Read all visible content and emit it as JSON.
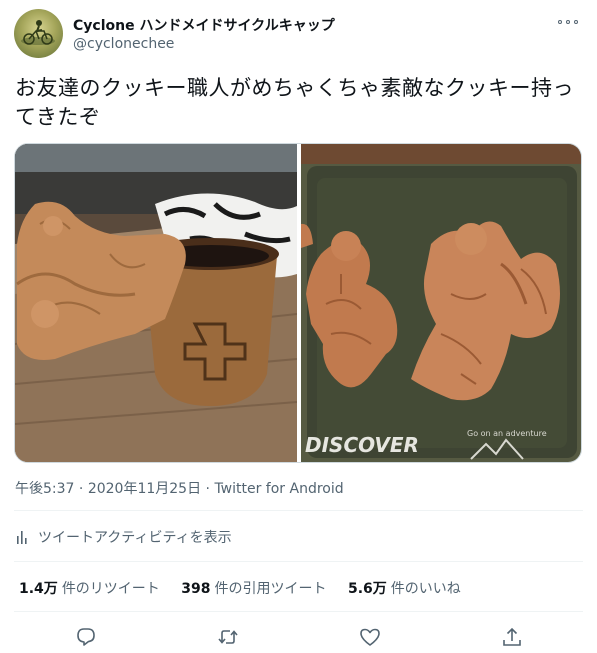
{
  "author": {
    "name": "Cyclone ハンドメイドサイクルキャップ",
    "handle": "@cyclonechee"
  },
  "tweet": {
    "text": "お友達のクッキー職人がめちゃくちゃ素敵なクッキー持ってきたぞ",
    "time": "午後5:37",
    "separator1": " · ",
    "date": "2020年11月25日",
    "separator2": " · ",
    "source": "Twitter for Android"
  },
  "media": {
    "photo2_tray_text": "DISCOVER",
    "photo2_tray_small_text": "Go on an adventure"
  },
  "activity": {
    "label": "ツイートアクティビティを表示",
    "icon": "bar-chart-icon"
  },
  "stats": {
    "retweets_count": "1.4万",
    "retweets_label": "件のリツイート",
    "quotes_count": "398",
    "quotes_label": "件の引用ツイート",
    "likes_count": "5.6万",
    "likes_label": "件のいいね"
  },
  "actions": {
    "reply_icon": "reply-icon",
    "retweet_icon": "retweet-icon",
    "like_icon": "heart-icon",
    "share_icon": "share-icon"
  },
  "colors": {
    "text": "#0f1419",
    "secondary": "#536471",
    "divider": "#eff3f4"
  }
}
